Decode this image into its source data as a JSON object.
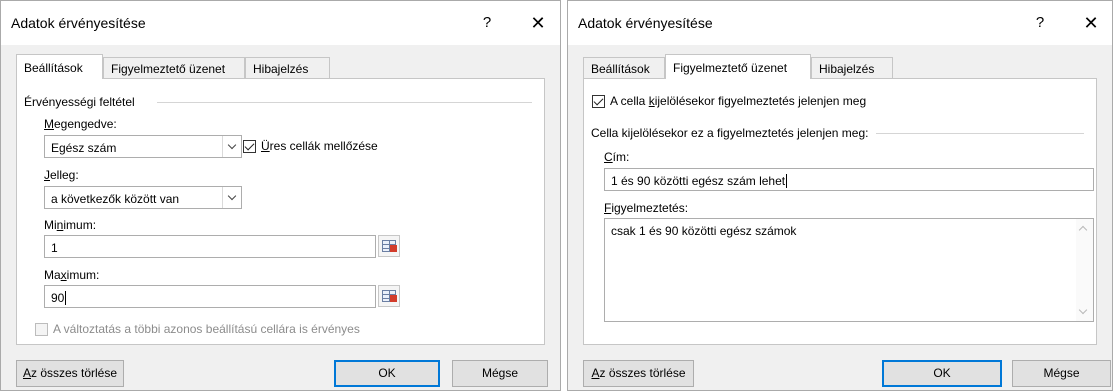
{
  "dialog1": {
    "title": "Adatok érvényesítése",
    "help": "?",
    "close": "✕",
    "tabs": [
      {
        "label": "Beállítások",
        "active": true
      },
      {
        "label": "Figyelmeztető üzenet",
        "active": false
      },
      {
        "label": "Hibajelzés",
        "active": false
      }
    ],
    "group_label": "Érvényességi feltétel",
    "allow": {
      "label_u": "M",
      "label_rest": "egengedve:",
      "value": "Egész szám"
    },
    "ignore_blank": {
      "label_pre": "",
      "label_u": "Ü",
      "label_rest": "res cellák mellőzése",
      "checked": true
    },
    "data": {
      "label_u": "J",
      "label_rest": "elleg:",
      "value": "a következők között van"
    },
    "minimum": {
      "label_pre": "Mi",
      "label_u": "n",
      "label_rest": "imum:",
      "value": "1"
    },
    "maximum": {
      "label_pre": "Ma",
      "label_u": "x",
      "label_rest": "imum:",
      "value": "90"
    },
    "apply_all": {
      "label": "A változtatás a többi azonos beállítású cellára is érvényes",
      "checked": false,
      "disabled": true
    },
    "buttons": {
      "clear_u": "A",
      "clear_rest": "z összes törlése",
      "ok": "OK",
      "cancel": "Mégse"
    }
  },
  "dialog2": {
    "title": "Adatok érvényesítése",
    "help": "?",
    "close": "✕",
    "tabs": [
      {
        "label": "Beállítások",
        "active": false
      },
      {
        "label": "Figyelmeztető üzenet",
        "active": true
      },
      {
        "label": "Hibajelzés",
        "active": false
      }
    ],
    "show_message": {
      "label_pre": "A cella ",
      "label_u": "k",
      "label_rest": "ijelölésekor figyelmeztetés jelenjen meg",
      "checked": true
    },
    "group_label": "Cella kijelölésekor ez a figyelmeztetés jelenjen meg:",
    "title_field": {
      "label_u": "C",
      "label_rest": "ím:",
      "value": "1 és 90 közötti egész szám lehet"
    },
    "message_field": {
      "label_u": "F",
      "label_rest": "igyelmeztetés:",
      "value": "csak 1 és 90 közötti egész számok"
    },
    "buttons": {
      "clear_u": "A",
      "clear_rest": "z összes törlése",
      "ok": "OK",
      "cancel": "Mégse"
    }
  }
}
